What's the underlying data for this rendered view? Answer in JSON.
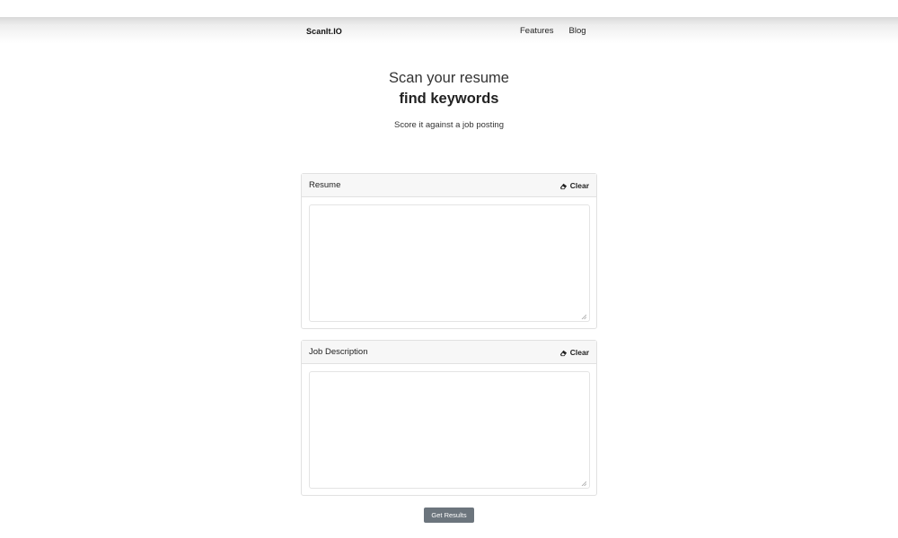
{
  "navbar": {
    "brand": "ScanIt.IO",
    "links": [
      "Features",
      "Blog"
    ]
  },
  "hero": {
    "title": "Scan your resume",
    "subtitle": "find keywords",
    "tagline": "Score it against a job posting"
  },
  "resume_card": {
    "title": "Resume",
    "clear_label": "Clear",
    "clear_icon": "eraser-icon",
    "value": "",
    "placeholder": ""
  },
  "job_card": {
    "title": "Job Description",
    "clear_label": "Clear",
    "clear_icon": "eraser-icon",
    "value": "",
    "placeholder": ""
  },
  "submit": {
    "label": "Get Results",
    "color": "#6c757d"
  }
}
